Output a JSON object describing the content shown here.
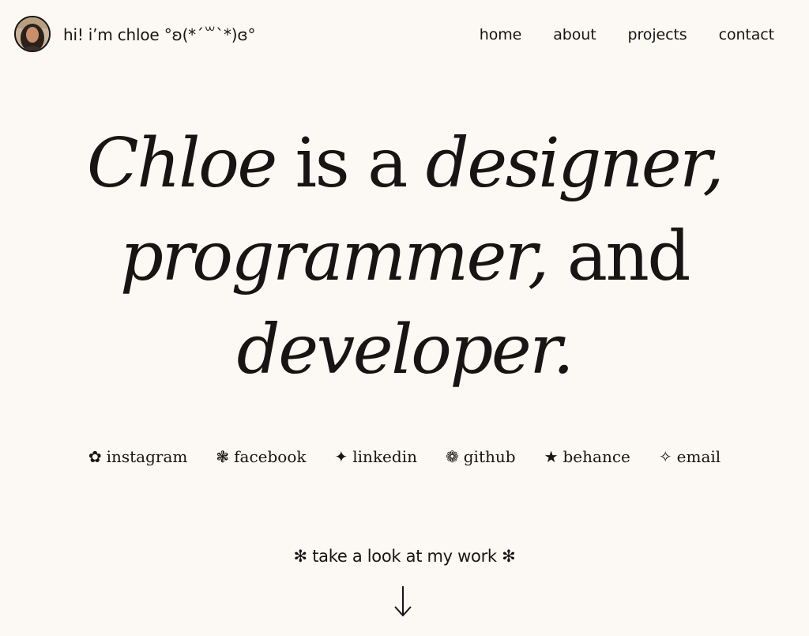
{
  "header": {
    "greeting": "hi! i’m chloe °ʚ(*´꒳`*)ɞ°",
    "nav": [
      {
        "label": "home"
      },
      {
        "label": "about"
      },
      {
        "label": "projects"
      },
      {
        "label": "contact"
      }
    ]
  },
  "hero": {
    "name": "Chloe",
    "is_a": " is a ",
    "designer": "designer,",
    "programmer": "programmer,",
    "and": " and",
    "developer": "developer."
  },
  "socials": [
    {
      "icon": "flower-icon",
      "glyph": "✿",
      "label": "instagram"
    },
    {
      "icon": "asterisk-flower-icon",
      "glyph": "❃",
      "label": "facebook"
    },
    {
      "icon": "four-point-star-icon",
      "glyph": "✦",
      "label": "linkedin"
    },
    {
      "icon": "rosette-icon",
      "glyph": "❁",
      "label": "github"
    },
    {
      "icon": "star-icon",
      "glyph": "★",
      "label": "behance"
    },
    {
      "icon": "outline-sparkle-icon",
      "glyph": "✧",
      "label": "email"
    }
  ],
  "cta": {
    "star_left": "✻",
    "label": " take a look at my work ",
    "star_right": "✻"
  },
  "colors": {
    "background": "#fcf8f3",
    "text": "#161514"
  }
}
